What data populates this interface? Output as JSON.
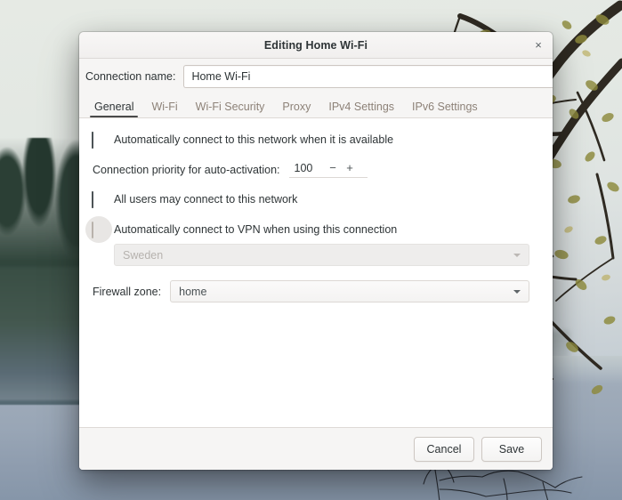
{
  "window": {
    "title": "Editing Home Wi-Fi",
    "close_icon": "close-icon",
    "close_glyph": "×"
  },
  "connection_name": {
    "label": "Connection name:",
    "value": "Home Wi-Fi",
    "placeholder": ""
  },
  "tabs": [
    {
      "label": "General",
      "active": true
    },
    {
      "label": "Wi-Fi",
      "active": false
    },
    {
      "label": "Wi-Fi Security",
      "active": false
    },
    {
      "label": "Proxy",
      "active": false
    },
    {
      "label": "IPv4 Settings",
      "active": false
    },
    {
      "label": "IPv6 Settings",
      "active": false
    }
  ],
  "general": {
    "auto_connect": {
      "label": "Automatically connect to this network when it is available",
      "checked": true
    },
    "priority": {
      "label": "Connection priority for auto-activation:",
      "value": "100",
      "minus_glyph": "−",
      "plus_glyph": "+"
    },
    "all_users": {
      "label": "All users may connect to this network",
      "checked": true
    },
    "vpn": {
      "label": "Automatically connect to VPN when using this connection",
      "checked": false,
      "focused": true,
      "combo_value": "Sweden",
      "combo_disabled": true
    },
    "firewall": {
      "label": "Firewall zone:",
      "value": "home"
    }
  },
  "footer": {
    "cancel_label": "Cancel",
    "save_label": "Save"
  },
  "colors": {
    "dialog_bg": "#f6f5f4",
    "content_bg": "#ffffff",
    "text": "#2e3436",
    "tab_inactive": "#8d8278",
    "checkbox_checked": "#5c6366",
    "border": "#cdc7c2"
  }
}
